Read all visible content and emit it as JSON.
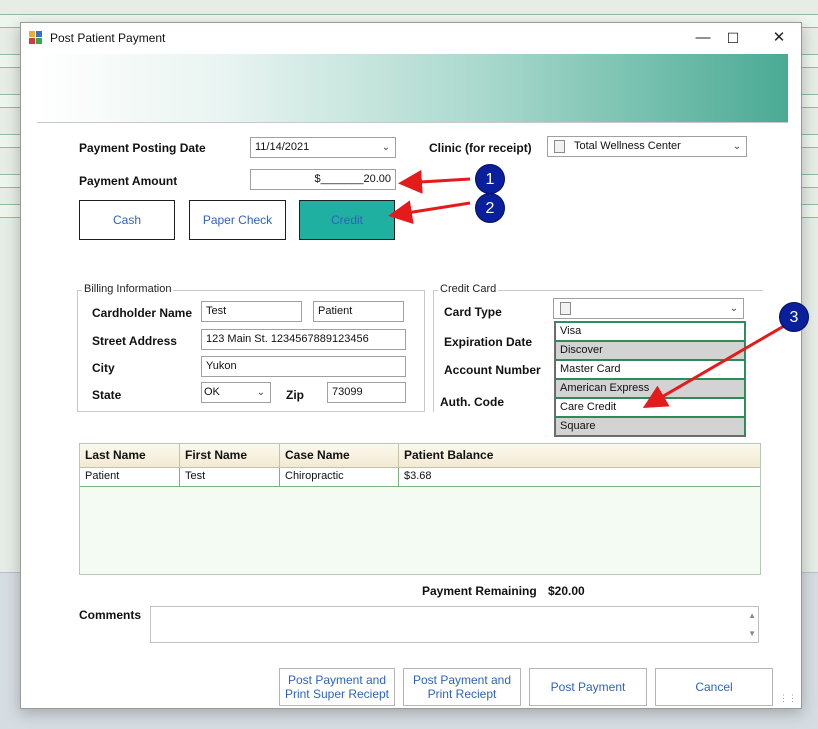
{
  "window": {
    "title": "Post Patient Payment",
    "minimize": "—",
    "maximize": "☐",
    "close": "✕"
  },
  "posting": {
    "date_label": "Payment Posting Date",
    "date_value": "11/14/2021",
    "clinic_label": "Clinic (for receipt)",
    "clinic_value": "Total Wellness Center",
    "amount_label": "Payment Amount",
    "amount_value": "$_______20.00"
  },
  "payment_methods": {
    "cash": "Cash",
    "paper_check": "Paper Check",
    "credit": "Credit"
  },
  "billing": {
    "group_title": "Billing Information",
    "cardholder_label": "Cardholder Name",
    "first_name": "Test",
    "last_name": "Patient",
    "street_label": "Street Address",
    "street_value": "123 Main St. 1234567889123456",
    "city_label": "City",
    "city_value": "Yukon",
    "state_label": "State",
    "state_value": "OK",
    "zip_label": "Zip",
    "zip_value": "73099"
  },
  "credit_card": {
    "group_title": "Credit Card",
    "card_type_label": "Card Type",
    "expiration_label": "Expiration Date",
    "account_label": "Account Number",
    "auth_label": "Auth. Code",
    "card_types": [
      "Visa",
      "Discover",
      "Master Card",
      "American Express",
      "Care Credit",
      "Square"
    ]
  },
  "grid": {
    "columns": [
      "Last Name",
      "First Name",
      "Case Name",
      "Patient Balance"
    ],
    "rows": [
      [
        "Patient",
        "Test",
        "Chiropractic",
        "$3.68"
      ]
    ]
  },
  "summary": {
    "remaining_label": "Payment Remaining",
    "remaining_value": "$20.00"
  },
  "comments": {
    "label": "Comments"
  },
  "buttons": {
    "post_super_line1": "Post Payment and",
    "post_super_line2": "Print Super Reciept",
    "post_receipt_line1": "Post Payment and",
    "post_receipt_line2": "Print Reciept",
    "post_payment": "Post Payment",
    "cancel": "Cancel"
  },
  "callouts": [
    "1",
    "2",
    "3"
  ],
  "colors": {
    "credit_active": "#1fb0a2",
    "link_blue": "#2f63b8",
    "callout": "#0a1f9c",
    "arrow": "#e51a1a"
  }
}
